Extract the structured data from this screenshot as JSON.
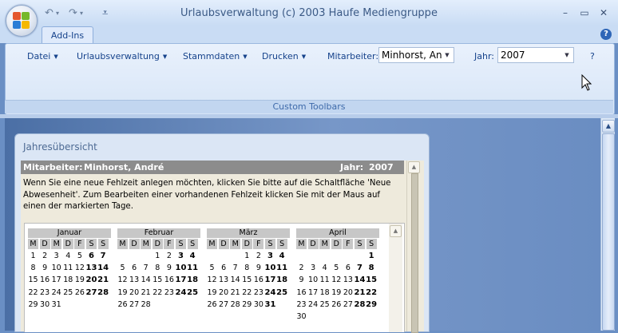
{
  "window": {
    "title": "Urlaubsverwaltung (c) 2003 Haufe Mediengruppe",
    "qat": {
      "undo": "↶",
      "redo": "↷",
      "customize": "⩡"
    },
    "controls": {
      "minimize": "–",
      "maximize": "▭",
      "close": "✕"
    }
  },
  "tabs": [
    {
      "label": "Add-Ins"
    }
  ],
  "help": "?",
  "toolbar": {
    "menus": [
      {
        "label": "Datei"
      },
      {
        "label": "Urlaubsverwaltung"
      },
      {
        "label": "Stammdaten"
      },
      {
        "label": "Drucken"
      }
    ],
    "employee_label": "Mitarbeiter:",
    "employee_value": "Minhorst, André",
    "year_label": "Jahr:",
    "year_value": "2007",
    "question": "?",
    "group_label": "Custom Toolbars"
  },
  "form": {
    "title": "Jahresübersicht",
    "employee_label": "Mitarbeiter:",
    "employee_name": "Minhorst, André",
    "year_label": "Jahr:",
    "year": "2007",
    "info": "Wenn Sie eine neue Fehlzeit anlegen möchten, klicken Sie bitte auf die Schaltfläche 'Neue Abwesenheit'. Zum Bearbeiten einer vorhandenen Fehlzeit klicken Sie mit der Maus auf einen der markierten Tage."
  },
  "calendar": {
    "weekdays": [
      "M",
      "D",
      "M",
      "D",
      "F",
      "S",
      "S"
    ],
    "months": [
      {
        "name": "Januar",
        "start": 0,
        "days": 31
      },
      {
        "name": "Februar",
        "start": 3,
        "days": 28
      },
      {
        "name": "März",
        "start": 3,
        "days": 31
      },
      {
        "name": "April",
        "start": 6,
        "days": 30
      }
    ]
  }
}
